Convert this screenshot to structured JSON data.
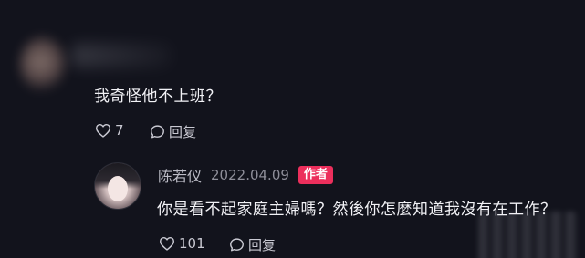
{
  "comment1": {
    "text": "我奇怪他不上班？",
    "like_count": "7",
    "reply_label": "回复"
  },
  "comment2": {
    "username": "陈若仪",
    "date": "2022.04.09",
    "badge": "作者",
    "text": "你是看不起家庭主婦嗎？然後你怎麼知道我沒有在工作？",
    "like_count": "101",
    "reply_label": "回复"
  },
  "colors": {
    "background": "#12131c",
    "badge": "#ec2f5c",
    "text": "#f2f2f6",
    "muted": "#8e8e99"
  },
  "icons": {
    "like": "heart-outline-icon",
    "reply": "speech-bubble-icon"
  }
}
